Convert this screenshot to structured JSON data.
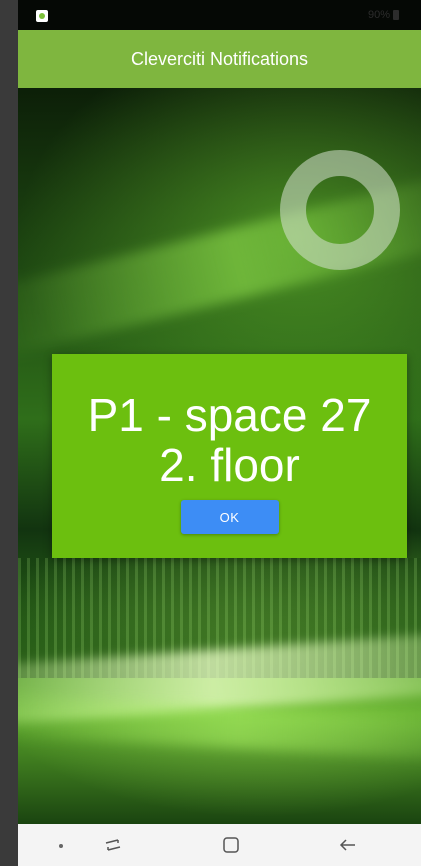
{
  "status_bar": {
    "battery_text": "90%"
  },
  "app_bar": {
    "title": "Cleverciti Notifications"
  },
  "dialog": {
    "line1": "P1 - space 27",
    "line2": "2. floor",
    "ok_label": "OK"
  },
  "nav_bar": {
    "icons": [
      "nav-dot-icon",
      "recent-apps-icon",
      "home-icon",
      "back-icon"
    ]
  },
  "colors": {
    "app_bar": "#7fb63f",
    "dialog_bg": "#6cbf0f",
    "ok_button": "#3d8df5"
  }
}
